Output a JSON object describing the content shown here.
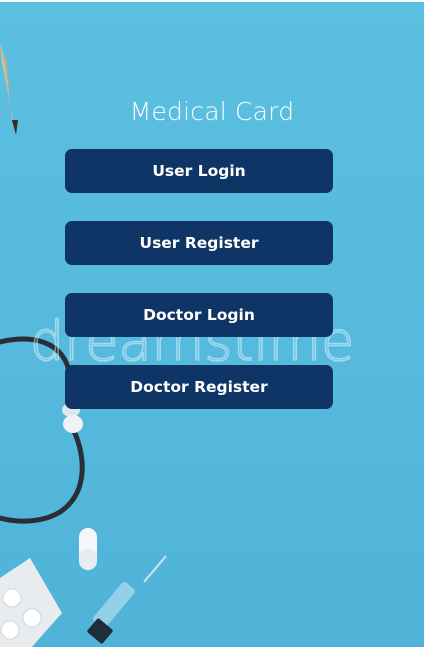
{
  "app": {
    "title": "Medical Card"
  },
  "buttons": {
    "user_login": "User Login",
    "user_register": "User Register",
    "doctor_login": "Doctor Login",
    "doctor_register": "Doctor Register"
  },
  "background": {
    "watermark_text": "dreamstime",
    "color": "#5bbfe0",
    "button_color": "#0e3566",
    "icons": [
      "pencil-icon",
      "stethoscope-icon",
      "pill-capsule-icon",
      "blister-pack-icon",
      "syringe-icon"
    ]
  }
}
